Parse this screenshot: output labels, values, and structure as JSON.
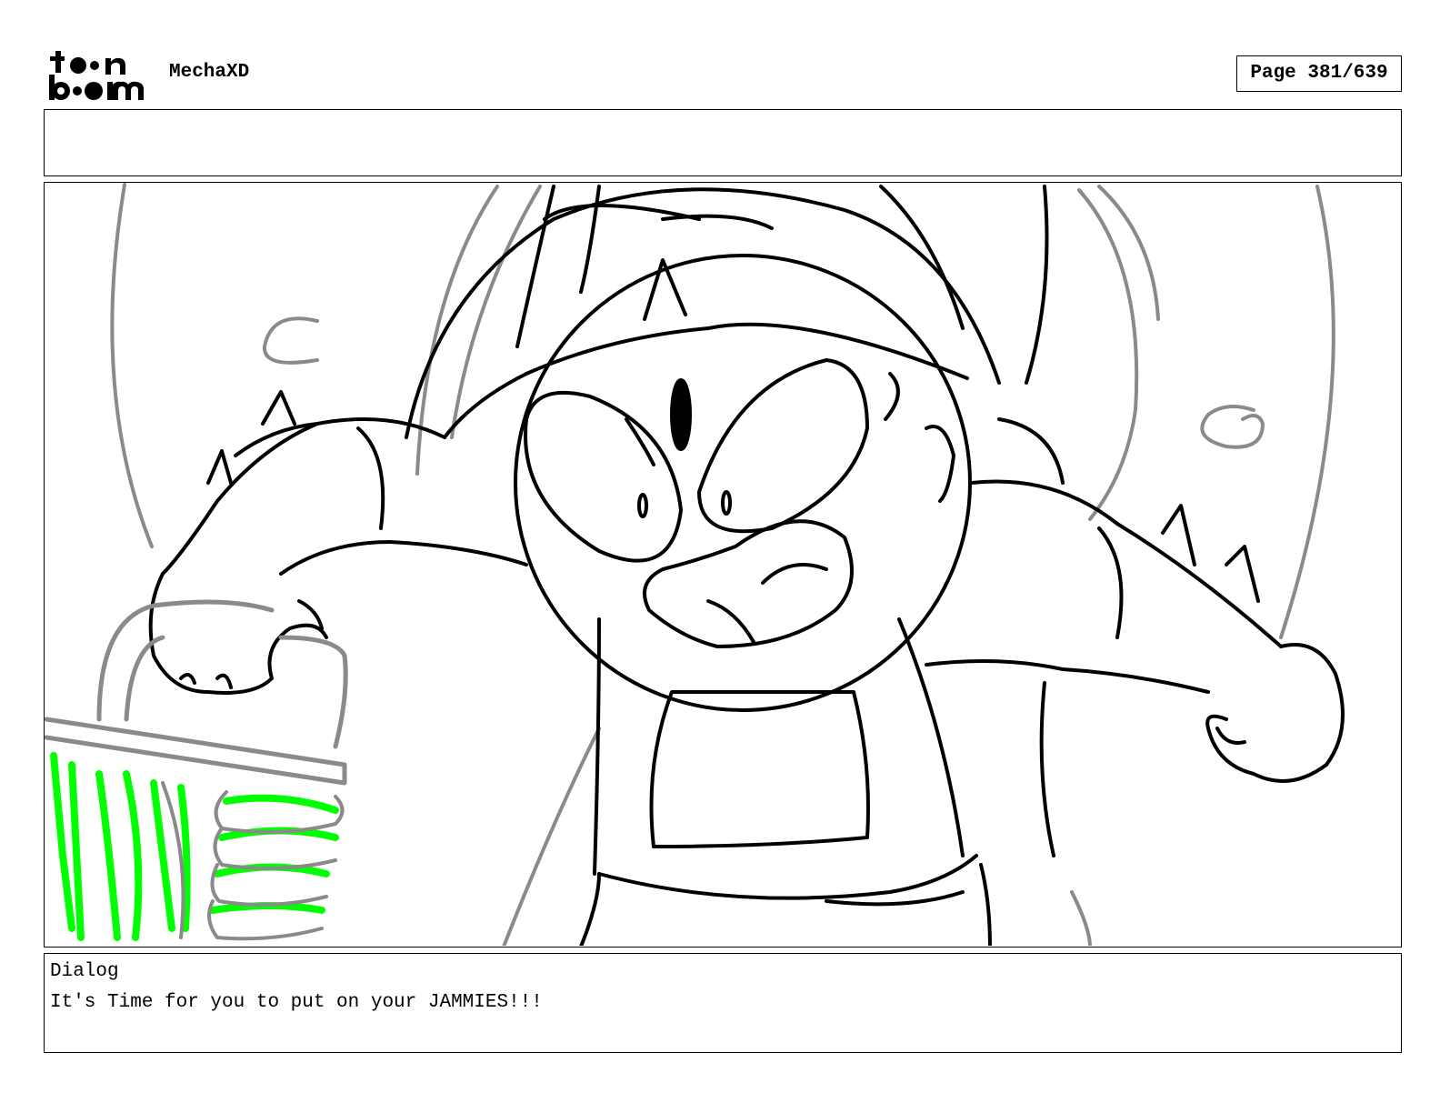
{
  "header": {
    "logo_text": "toon boom",
    "project_title": "MechaXD",
    "page_counter": "Page 381/639"
  },
  "panel": {
    "description_icon": "storyboard-sketch",
    "accent_colors": {
      "line": "#000000",
      "background_lines": "#8a8a8a",
      "highlight": "#00ff00"
    }
  },
  "dialog": {
    "label": "Dialog",
    "text": "It's Time for you to put on your JAMMIES!!!"
  }
}
